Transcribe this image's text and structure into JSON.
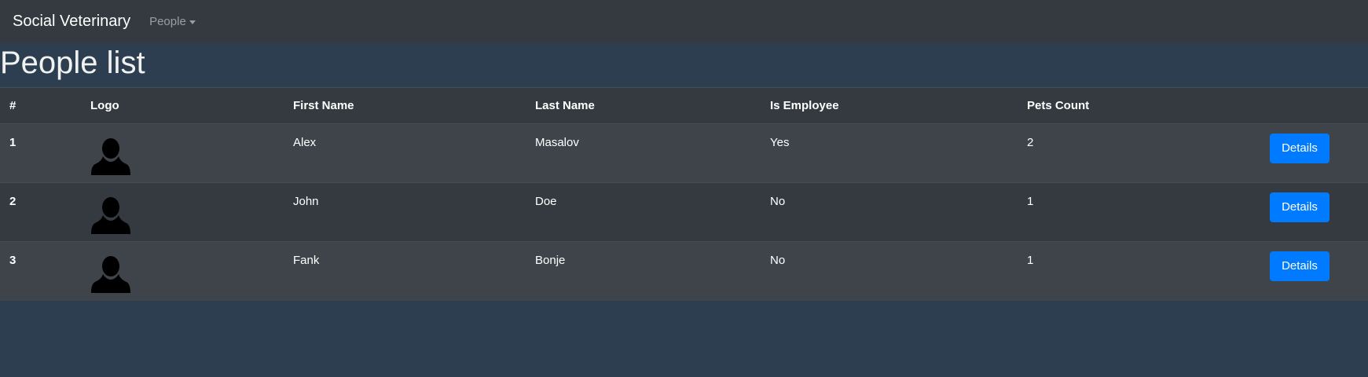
{
  "navbar": {
    "brand": "Social Veterinary",
    "dropdown_label": "People"
  },
  "page": {
    "title": "People list"
  },
  "table": {
    "columns": [
      "#",
      "Logo",
      "First Name",
      "Last Name",
      "Is Employee",
      "Pets Count",
      ""
    ],
    "rows": [
      {
        "id": "1",
        "first_name": "Alex",
        "last_name": "Masalov",
        "is_employee": "Yes",
        "pets_count": "2",
        "action": "Details"
      },
      {
        "id": "2",
        "first_name": "John",
        "last_name": "Doe",
        "is_employee": "No",
        "pets_count": "1",
        "action": "Details"
      },
      {
        "id": "3",
        "first_name": "Fank",
        "last_name": "Bonje",
        "is_employee": "No",
        "pets_count": "1",
        "action": "Details"
      }
    ]
  },
  "colors": {
    "navbar_bg": "#343a40",
    "page_bg": "#2c3e50",
    "button_primary": "#007bff",
    "row_odd": "#3f444b",
    "row_even": "#343a40"
  },
  "icons": {
    "avatar": "person-silhouette-icon",
    "dropdown": "caret-down-icon"
  }
}
